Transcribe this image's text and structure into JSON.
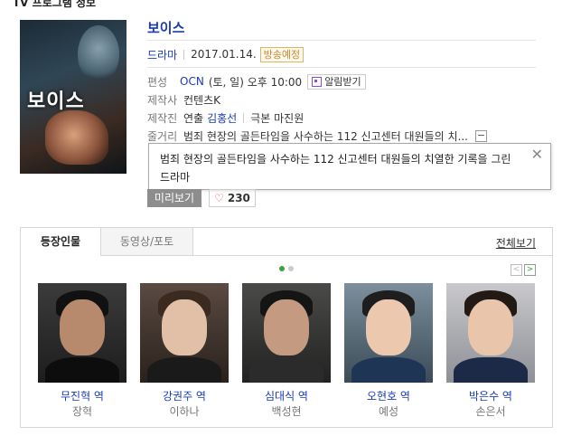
{
  "section_title": "TV 프로그램 정보",
  "program": {
    "title": "보이스",
    "poster_title": "보이스",
    "genre": "드라마",
    "date": "2017.01.14.",
    "status": "방송예정",
    "broadcast_label": "편성",
    "channel": "OCN",
    "schedule": "(토, 일) 오후 10:00",
    "alarm_label": "알림받기",
    "producer_label": "제작사",
    "producer": "컨텐츠K",
    "staff_label": "제작진",
    "director_prefix": "연출",
    "director": "김홍선",
    "writer": "극본 마진원",
    "plot_label": "줄거리",
    "plot_short": "범죄 현장의 골든타임을 사수하는 112 신고센터 대원들의 치...",
    "plot_full": "범죄 현장의 골든타임을 사수하는 112 신고센터 대원들의 치열한 기록을 그린 드라마",
    "preview_label": "미리보기",
    "like_count": "230"
  },
  "cast_section": {
    "tab_cast": "등장인물",
    "tab_video": "동영상/포토",
    "view_all": "전체보기",
    "page_current": 1,
    "page_total": 2,
    "members": [
      {
        "role": "무진혁 역",
        "actor": "장혁"
      },
      {
        "role": "강권주 역",
        "actor": "이하나"
      },
      {
        "role": "심대식 역",
        "actor": "백성현"
      },
      {
        "role": "오현호 역",
        "actor": "예성"
      },
      {
        "role": "박은수 역",
        "actor": "손은서"
      }
    ]
  },
  "colors": {
    "link_blue": "#1a3bb5",
    "badge_orange": "#c8872a",
    "heart_red": "#e0424f",
    "active_green": "#3aa33a"
  }
}
